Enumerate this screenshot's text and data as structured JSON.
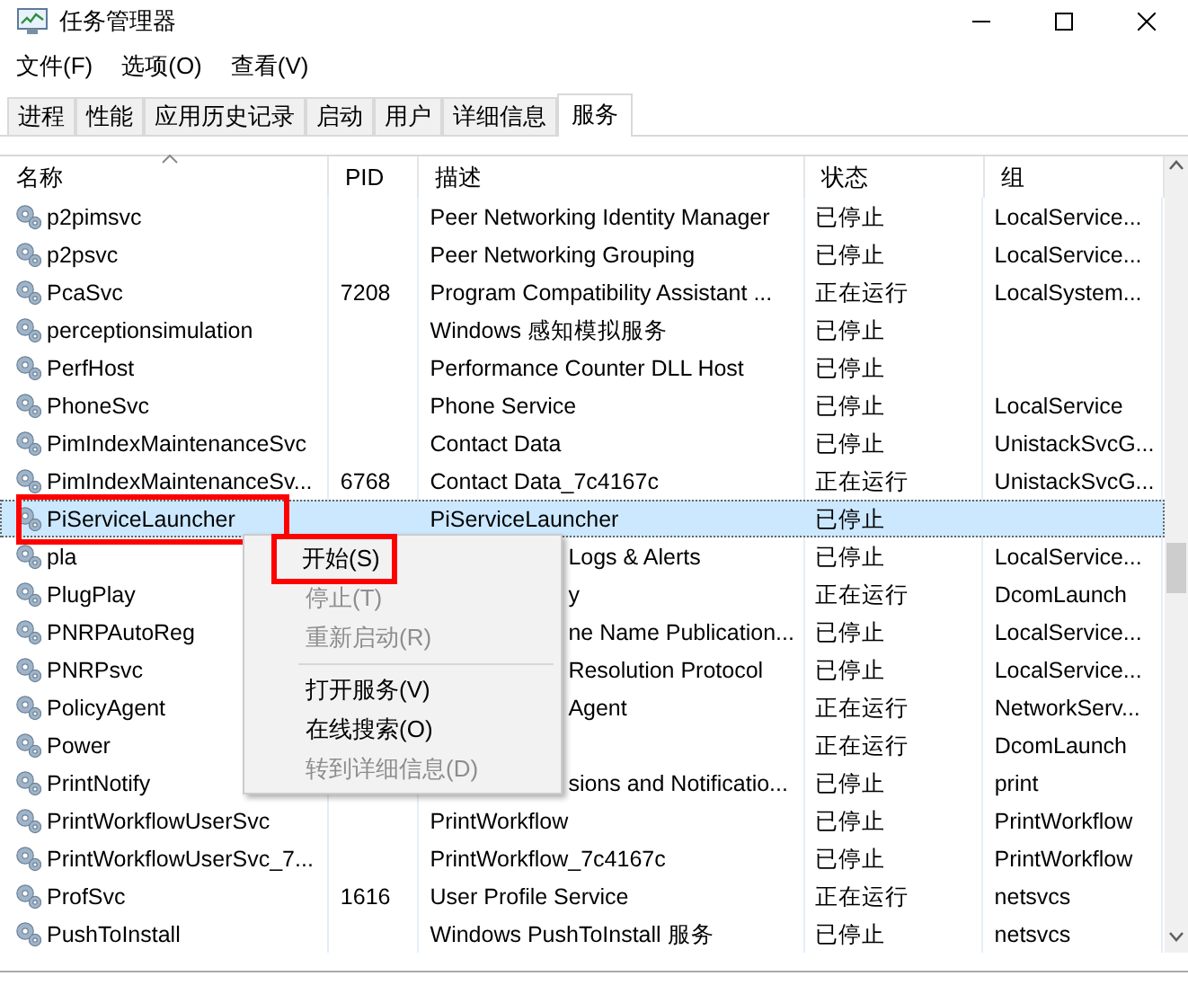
{
  "window": {
    "title": "任务管理器"
  },
  "menu_bar": [
    "文件(F)",
    "选项(O)",
    "查看(V)"
  ],
  "tabs": [
    {
      "label": "进程",
      "selected": false
    },
    {
      "label": "性能",
      "selected": false
    },
    {
      "label": "应用历史记录",
      "selected": false
    },
    {
      "label": "启动",
      "selected": false
    },
    {
      "label": "用户",
      "selected": false
    },
    {
      "label": "详细信息",
      "selected": false
    },
    {
      "label": "服务",
      "selected": true
    }
  ],
  "table": {
    "columns": [
      "名称",
      "PID",
      "描述",
      "状态",
      "组"
    ],
    "rows": [
      {
        "name": "p2pimsvc",
        "pid": "",
        "description": "Peer Networking Identity Manager",
        "status": "已停止",
        "group": "LocalService...",
        "selected": false
      },
      {
        "name": "p2psvc",
        "pid": "",
        "description": "Peer Networking Grouping",
        "status": "已停止",
        "group": "LocalService...",
        "selected": false
      },
      {
        "name": "PcaSvc",
        "pid": "7208",
        "description": "Program Compatibility Assistant ...",
        "status": "正在运行",
        "group": "LocalSystem...",
        "selected": false
      },
      {
        "name": "perceptionsimulation",
        "pid": "",
        "description": "Windows 感知模拟服务",
        "status": "已停止",
        "group": "",
        "selected": false
      },
      {
        "name": "PerfHost",
        "pid": "",
        "description": "Performance Counter DLL Host",
        "status": "已停止",
        "group": "",
        "selected": false
      },
      {
        "name": "PhoneSvc",
        "pid": "",
        "description": "Phone Service",
        "status": "已停止",
        "group": "LocalService",
        "selected": false
      },
      {
        "name": "PimIndexMaintenanceSvc",
        "pid": "",
        "description": "Contact Data",
        "status": "已停止",
        "group": "UnistackSvcG...",
        "selected": false
      },
      {
        "name": "PimIndexMaintenanceSv...",
        "pid": "6768",
        "description": "Contact Data_7c4167c",
        "status": "正在运行",
        "group": "UnistackSvcG...",
        "selected": false
      },
      {
        "name": "PiServiceLauncher",
        "pid": "",
        "description": "PiServiceLauncher",
        "status": "已停止",
        "group": "",
        "selected": true,
        "highlighted": true
      },
      {
        "name": "pla",
        "pid": "",
        "description": "Logs & Alerts",
        "description_covered": true,
        "status": "已停止",
        "group": "LocalService...",
        "selected": false
      },
      {
        "name": "PlugPlay",
        "pid": "",
        "description": "y",
        "description_covered": true,
        "status": "正在运行",
        "group": "DcomLaunch",
        "selected": false
      },
      {
        "name": "PNRPAutoReg",
        "pid": "",
        "description": "ne Name Publication...",
        "description_covered": true,
        "status": "已停止",
        "group": "LocalService...",
        "selected": false
      },
      {
        "name": "PNRPsvc",
        "pid": "",
        "description": "Resolution Protocol",
        "description_covered": true,
        "status": "已停止",
        "group": "LocalService...",
        "selected": false
      },
      {
        "name": "PolicyAgent",
        "pid": "",
        "description": "Agent",
        "description_covered": true,
        "status": "正在运行",
        "group": "NetworkServ...",
        "selected": false
      },
      {
        "name": "Power",
        "pid": "",
        "description": "",
        "description_covered": true,
        "status": "正在运行",
        "group": "DcomLaunch",
        "selected": false
      },
      {
        "name": "PrintNotify",
        "pid": "",
        "description": "sions and Notificatio...",
        "description_covered": true,
        "status": "已停止",
        "group": "print",
        "selected": false
      },
      {
        "name": "PrintWorkflowUserSvc",
        "pid": "",
        "description": "PrintWorkflow",
        "status": "已停止",
        "group": "PrintWorkflow",
        "selected": false
      },
      {
        "name": "PrintWorkflowUserSvc_7...",
        "pid": "",
        "description": "PrintWorkflow_7c4167c",
        "status": "已停止",
        "group": "PrintWorkflow",
        "selected": false
      },
      {
        "name": "ProfSvc",
        "pid": "1616",
        "description": "User Profile Service",
        "status": "正在运行",
        "group": "netsvcs",
        "selected": false
      },
      {
        "name": "PushToInstall",
        "pid": "",
        "description": "Windows PushToInstall 服务",
        "status": "已停止",
        "group": "netsvcs",
        "selected": false
      }
    ]
  },
  "context_menu": [
    {
      "kind": "item",
      "label": "开始(S)",
      "disabled": false,
      "highlighted": true
    },
    {
      "kind": "item",
      "label": "停止(T)",
      "disabled": true
    },
    {
      "kind": "item",
      "label": "重新启动(R)",
      "disabled": true
    },
    {
      "kind": "separator"
    },
    {
      "kind": "item",
      "label": "打开服务(V)",
      "disabled": false
    },
    {
      "kind": "item",
      "label": "在线搜索(O)",
      "disabled": false
    },
    {
      "kind": "item",
      "label": "转到详细信息(D)",
      "disabled": true
    }
  ]
}
